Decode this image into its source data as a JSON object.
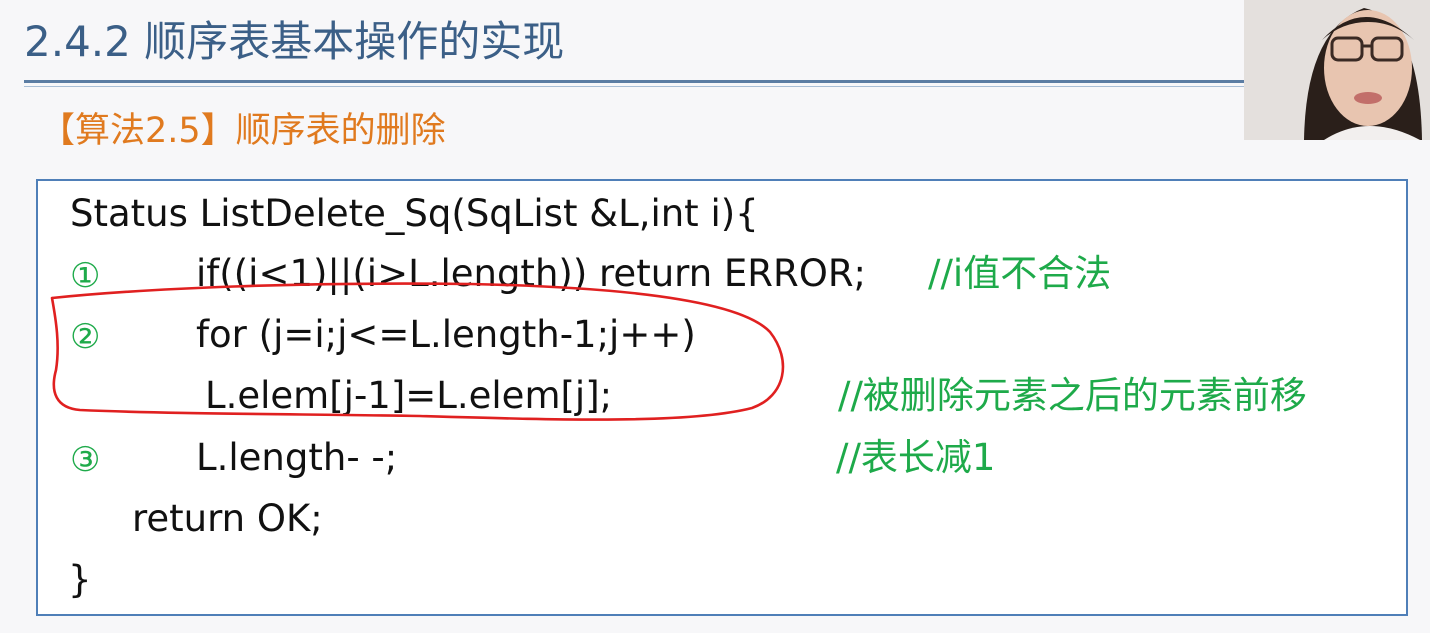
{
  "slide": {
    "title": "2.4.2 顺序表基本操作的实现",
    "subtitle": "【算法2.5】顺序表的删除"
  },
  "code": {
    "line1": "Status ListDelete_Sq(SqList &L,int i){",
    "line2": "if((i<1)||(i>L.length)) return ERROR;",
    "line3": "for (j=i;j<=L.length-1;j++)",
    "line4": "L.elem[j-1]=L.elem[j];",
    "line5": "L.length- -;",
    "line6": "return OK;",
    "line7": "}"
  },
  "markers": {
    "m1": "①",
    "m2": "②",
    "m3": "③"
  },
  "comments": {
    "c1": "//i值不合法",
    "c2": "//被删除元素之后的元素前移",
    "c3": "//表长减1"
  },
  "colors": {
    "title": "#3b5f87",
    "subtitle": "#e07a1f",
    "comment": "#1eaa4a",
    "box_border": "#4f7fb8",
    "annotation": "#e02020"
  }
}
